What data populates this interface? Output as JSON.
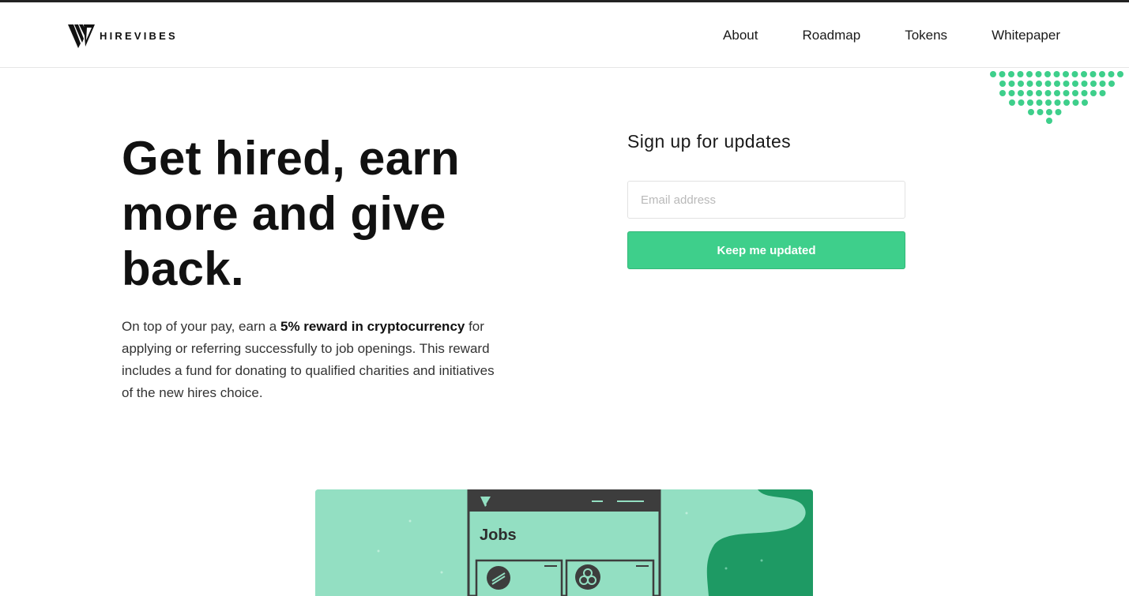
{
  "brand": {
    "name": "HIREVIBES",
    "logo_icon": "hirevibes-logo-icon"
  },
  "nav": {
    "items": [
      {
        "label": "About"
      },
      {
        "label": "Roadmap"
      },
      {
        "label": "Tokens"
      },
      {
        "label": "Whitepaper"
      }
    ]
  },
  "hero": {
    "title": "Get hired, earn more and give back.",
    "text_before": "On top of your pay, earn a ",
    "text_bold": "5% reward in cryptocurrency",
    "text_after": " for applying or referring successfully to job openings. This reward includes a fund for donating to qualified charities and initiatives of the new hires choice."
  },
  "signup": {
    "title": "Sign up for updates",
    "email_placeholder": "Email address",
    "email_value": "",
    "button_label": "Keep me updated"
  },
  "illustration": {
    "panel_title": "Jobs"
  },
  "colors": {
    "accent": "#3ecf8b",
    "illustration_bg": "#93dfc2",
    "illustration_dark": "#1e9a64",
    "window_frame": "#3d3d3d"
  }
}
